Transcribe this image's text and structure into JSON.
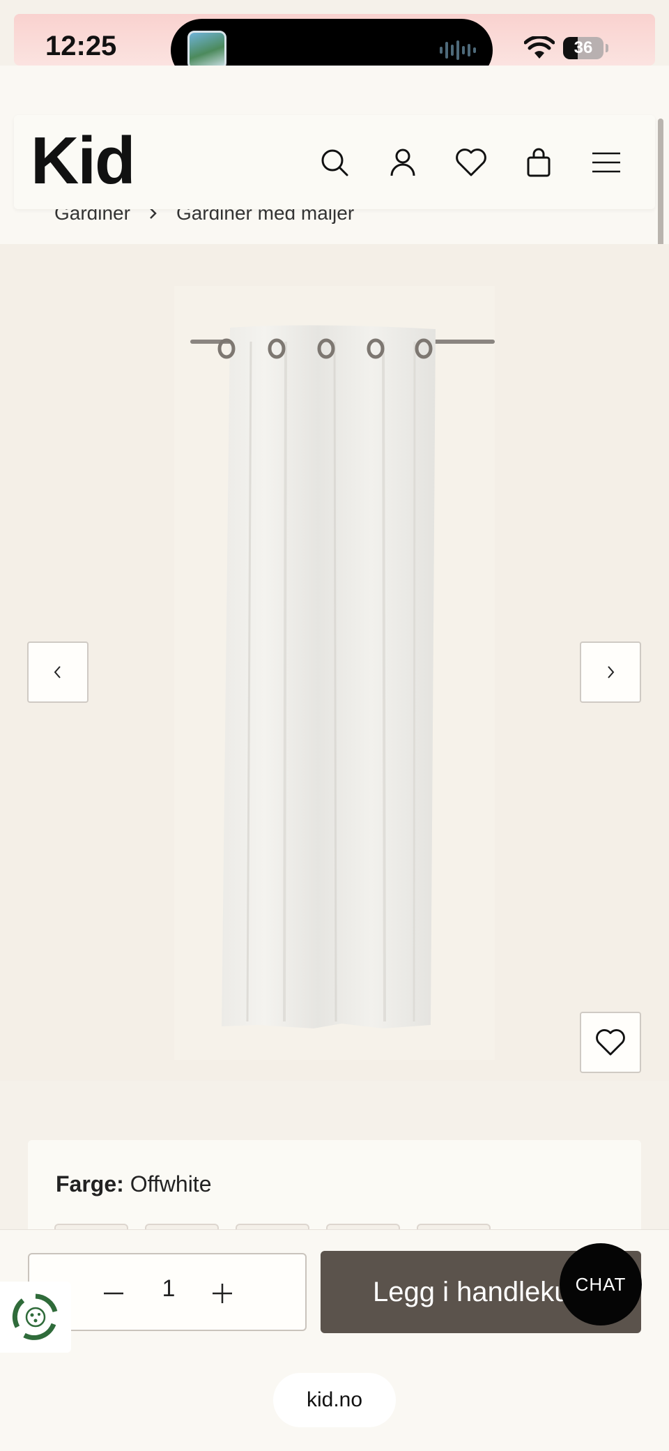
{
  "status_bar": {
    "time": "12:25",
    "battery": "36"
  },
  "header": {
    "logo": "Kid",
    "icons": [
      "search-icon",
      "account-icon",
      "heart-icon",
      "bag-icon",
      "menu-icon"
    ]
  },
  "breadcrumb": {
    "items": [
      "Gardiner",
      "Gardiner med maljer"
    ]
  },
  "product": {
    "image_alt": "Offwhite gardin med maljer"
  },
  "options": {
    "color_label": "Farge:",
    "color_value": "Offwhite"
  },
  "cart": {
    "quantity": "1",
    "add_label": "Legg i handlekurv",
    "chat_label": "CHAT"
  },
  "browser": {
    "url": "kid.no"
  },
  "colors": {
    "background": "#f5f1ea",
    "add_button": "#5b534c",
    "chat_button": "#050505"
  }
}
